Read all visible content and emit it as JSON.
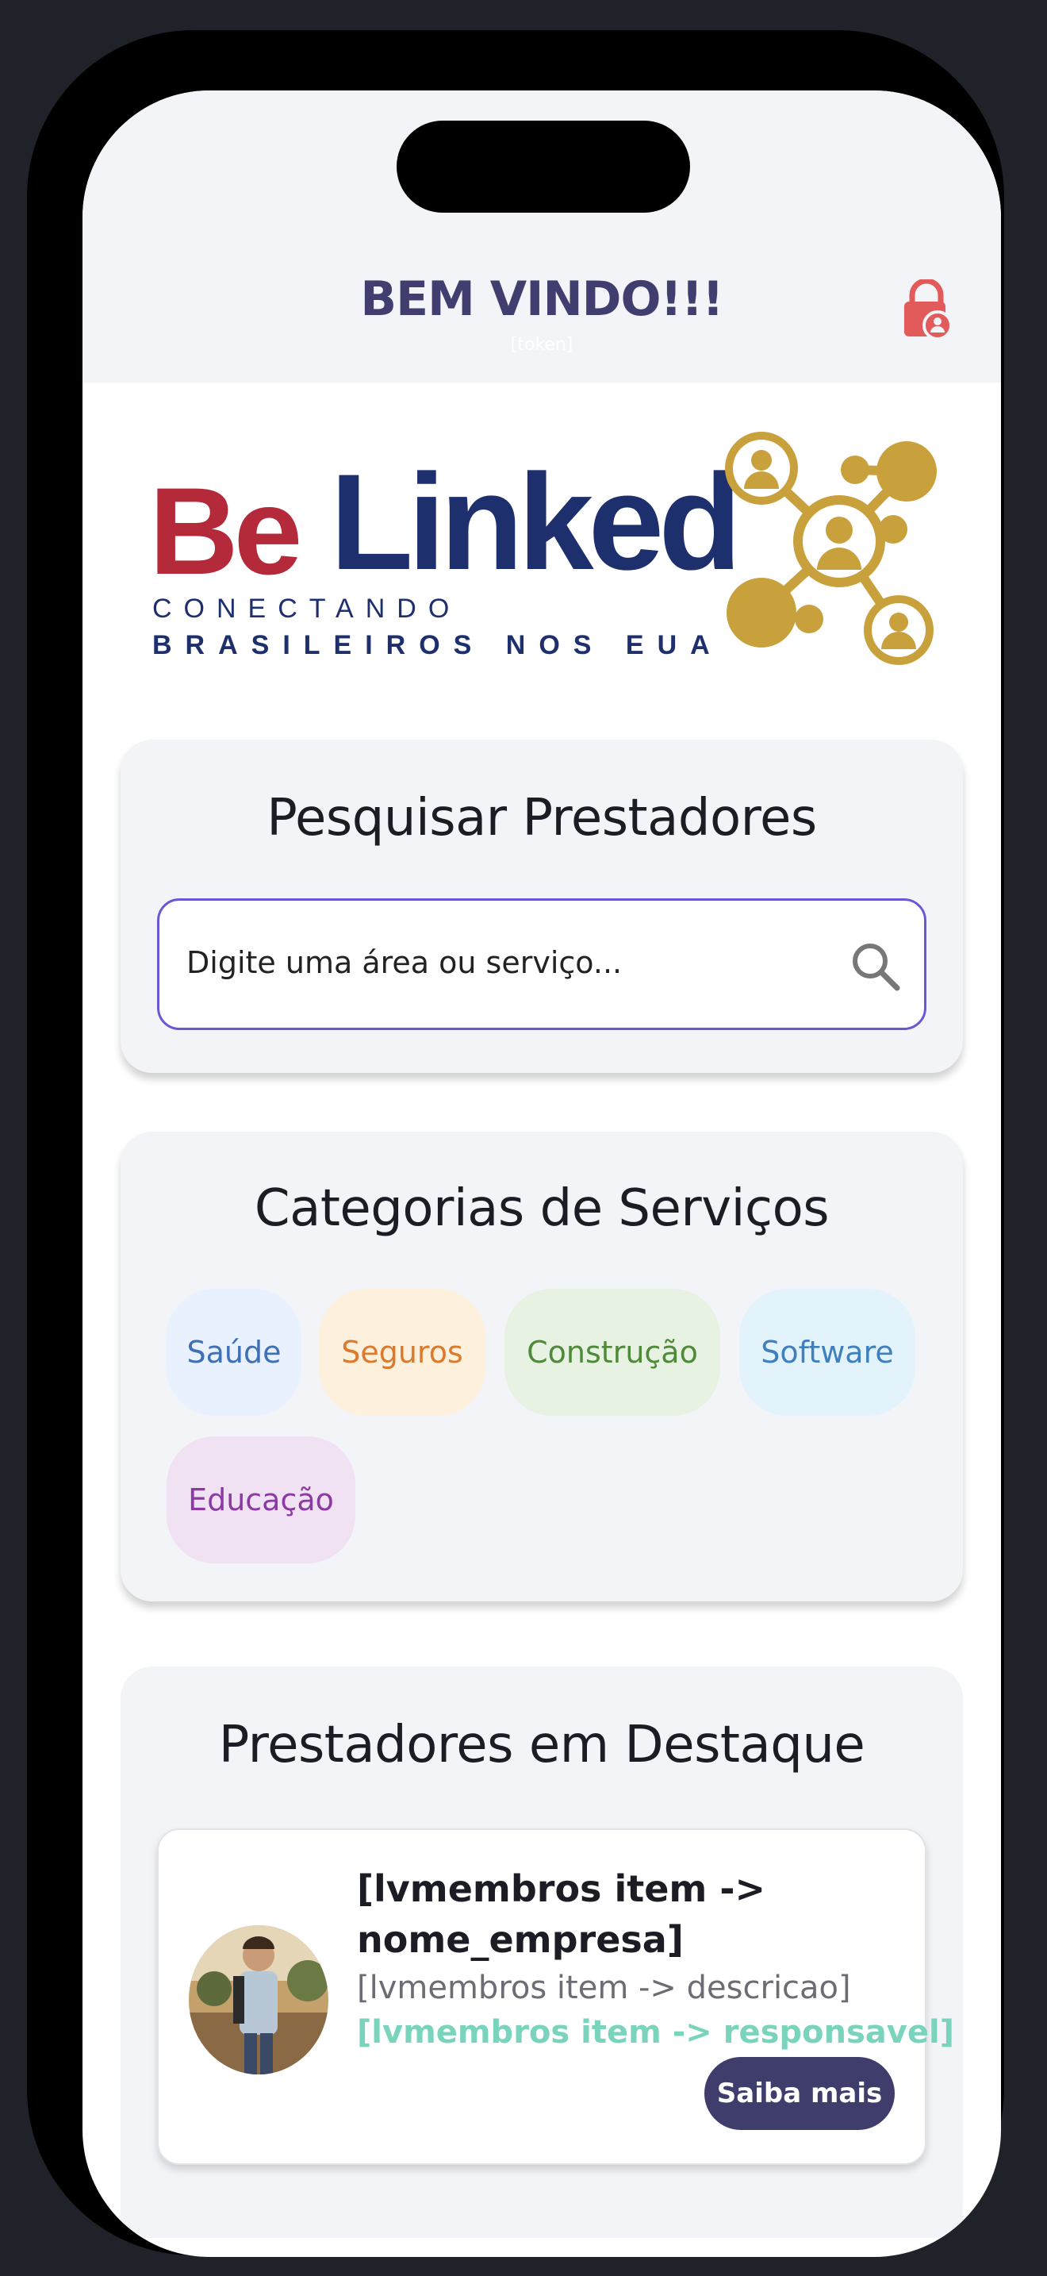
{
  "header": {
    "title": "BEM VINDO!!!",
    "token": "[token]",
    "logout_icon": "lock-user-icon"
  },
  "logo": {
    "word1": "Be",
    "word2": "Linked",
    "tagline1": "CONECTANDO",
    "tagline2": "BRASILEIROS NOS EUA"
  },
  "search": {
    "title": "Pesquisar Prestadores",
    "placeholder": "Digite uma área ou serviço...",
    "icon": "search-icon"
  },
  "categories": {
    "title": "Categorias de Serviços",
    "items": [
      {
        "label": "Saúde",
        "color": "#3f6fb5",
        "bg": "#e8f1fd"
      },
      {
        "label": "Seguros",
        "color": "#dc7a2c",
        "bg": "#fdf1de"
      },
      {
        "label": "Construção",
        "color": "#4f8a3a",
        "bg": "#e7f2e2"
      },
      {
        "label": "Software",
        "color": "#3f7fbd",
        "bg": "#e3f3fb"
      },
      {
        "label": "Educação",
        "color": "#8b3aa3",
        "bg": "#f1e2f3"
      }
    ]
  },
  "featured": {
    "title": "Prestadores em Destaque",
    "member": {
      "name": "[lvmembros item -> nome_empresa]",
      "description": "[lvmembros item -> descricao]",
      "responsible": "[lvmembros item -> responsavel]",
      "button": "Saiba mais"
    }
  },
  "colors": {
    "header_text": "#403e6f",
    "accent": "#6a57d6",
    "logo_red": "#b42a3a",
    "logo_blue": "#1e2f6e",
    "logo_gold": "#c9a13c",
    "lock": "#e25a5a"
  }
}
